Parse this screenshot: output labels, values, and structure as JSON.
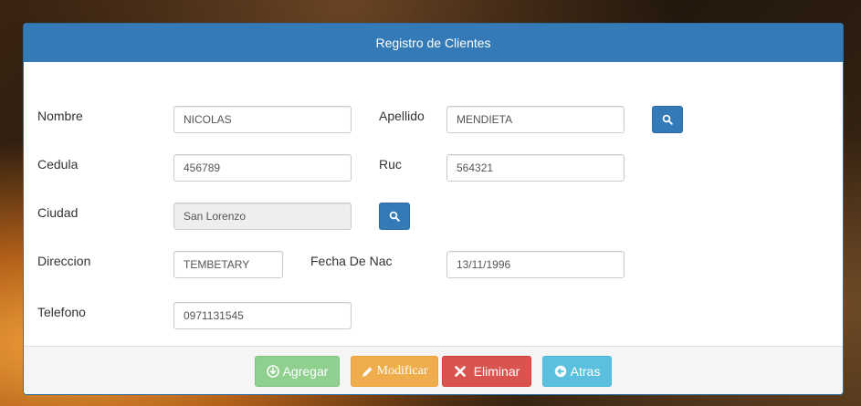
{
  "panel": {
    "title": "Registro de Clientes"
  },
  "form": {
    "nombre": {
      "label": "Nombre",
      "value": "NICOLAS"
    },
    "apellido": {
      "label": "Apellido",
      "value": "MENDIETA"
    },
    "cedula": {
      "label": "Cedula",
      "value": "456789"
    },
    "ruc": {
      "label": "Ruc",
      "value": "564321"
    },
    "ciudad": {
      "label": "Ciudad",
      "value": "San Lorenzo"
    },
    "direccion": {
      "label": "Direccion",
      "value": "TEMBETARY"
    },
    "fecha_nac": {
      "label": "Fecha De Nac",
      "value": "13/11/1996"
    },
    "telefono": {
      "label": "Telefono",
      "value": "0971131545"
    }
  },
  "buttons": {
    "agregar": "Agregar",
    "modificar": "Modificar",
    "eliminar": "Eliminar",
    "atras": "Atras"
  },
  "colors": {
    "primary": "#337ab7",
    "success": "#8fd08f",
    "warning": "#f0ad4e",
    "danger": "#d9534f",
    "info": "#5bc0de"
  },
  "icons": {
    "search": "search-icon",
    "agregar": "download-circle-icon",
    "modificar": "pencil-icon",
    "eliminar": "times-icon",
    "atras": "arrow-left-circle-icon"
  }
}
